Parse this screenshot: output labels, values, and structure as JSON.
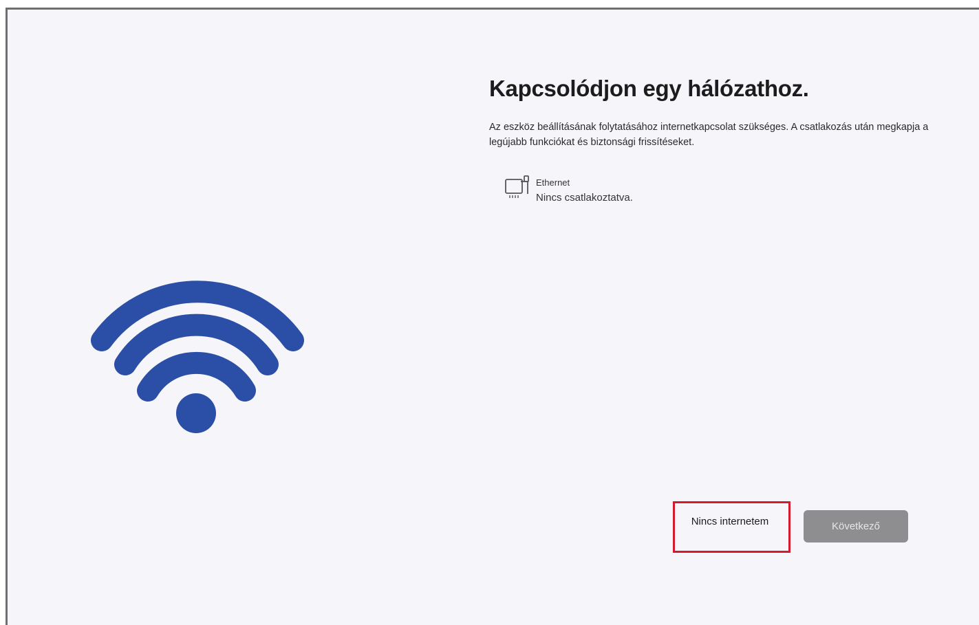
{
  "page": {
    "title": "Kapcsolódjon egy hálózathoz.",
    "description": "Az eszköz beállításának folytatásához internetkapcsolat szükséges. A csatlakozás után megkapja a legújabb funkciókat és biztonsági frissítéseket."
  },
  "network": {
    "icon": "ethernet-icon",
    "name": "Ethernet",
    "status": "Nincs csatlakoztatva."
  },
  "illustration": {
    "icon": "wifi-icon",
    "color": "#2b4ea6"
  },
  "buttons": {
    "no_internet_label": "Nincs internetem",
    "next_label": "Következő",
    "next_enabled": false
  },
  "annotation": {
    "highlight_color": "#d7192c"
  }
}
